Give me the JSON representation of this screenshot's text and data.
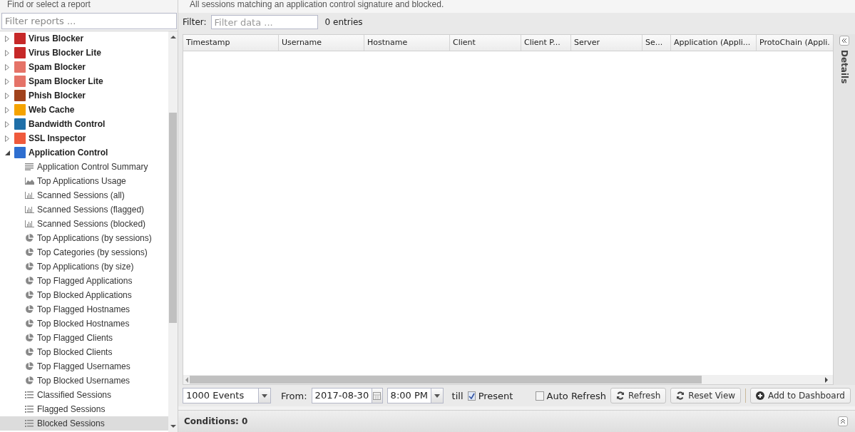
{
  "sidebar": {
    "title": "Find or select a report",
    "filter": {
      "placeholder": "Filter reports ..."
    },
    "tree": [
      {
        "label": "Virus Blocker",
        "expanded": false,
        "color": "#c62828"
      },
      {
        "label": "Virus Blocker Lite",
        "expanded": false,
        "color": "#c62828"
      },
      {
        "label": "Spam Blocker",
        "expanded": false,
        "color": "#e57368"
      },
      {
        "label": "Spam Blocker Lite",
        "expanded": false,
        "color": "#e57368"
      },
      {
        "label": "Phish Blocker",
        "expanded": false,
        "color": "#a0421c"
      },
      {
        "label": "Web Cache",
        "expanded": false,
        "color": "#f5a300"
      },
      {
        "label": "Bandwidth Control",
        "expanded": false,
        "color": "#1f6fa8"
      },
      {
        "label": "SSL Inspector",
        "expanded": false,
        "color": "#ef5a3c"
      },
      {
        "label": "Application Control",
        "expanded": true,
        "color": "#2f6fd0",
        "children": [
          {
            "label": "Application Control Summary",
            "kind": "text",
            "selected": false
          },
          {
            "label": "Top Applications Usage",
            "kind": "area",
            "selected": false
          },
          {
            "label": "Scanned Sessions (all)",
            "kind": "bar",
            "selected": false
          },
          {
            "label": "Scanned Sessions (flagged)",
            "kind": "bar",
            "selected": false
          },
          {
            "label": "Scanned Sessions (blocked)",
            "kind": "bar",
            "selected": false
          },
          {
            "label": "Top Applications (by sessions)",
            "kind": "pie",
            "selected": false
          },
          {
            "label": "Top Categories (by sessions)",
            "kind": "pie",
            "selected": false
          },
          {
            "label": "Top Applications (by size)",
            "kind": "pie",
            "selected": false
          },
          {
            "label": "Top Flagged Applications",
            "kind": "pie",
            "selected": false
          },
          {
            "label": "Top Blocked Applications",
            "kind": "pie",
            "selected": false
          },
          {
            "label": "Top Flagged Hostnames",
            "kind": "pie",
            "selected": false
          },
          {
            "label": "Top Blocked Hostnames",
            "kind": "pie",
            "selected": false
          },
          {
            "label": "Top Flagged Clients",
            "kind": "pie",
            "selected": false
          },
          {
            "label": "Top Blocked Clients",
            "kind": "pie",
            "selected": false
          },
          {
            "label": "Top Flagged Usernames",
            "kind": "pie",
            "selected": false
          },
          {
            "label": "Top Blocked Usernames",
            "kind": "pie",
            "selected": false
          },
          {
            "label": "Classified Sessions",
            "kind": "list",
            "selected": false
          },
          {
            "label": "Flagged Sessions",
            "kind": "list",
            "selected": false
          },
          {
            "label": "Blocked Sessions",
            "kind": "list",
            "selected": true
          }
        ]
      }
    ]
  },
  "report": {
    "description": "All sessions matching an application control signature and blocked.",
    "filter_label": "Filter:",
    "filter": {
      "placeholder": "Filter data ..."
    },
    "entries": "0 entries",
    "table": {
      "columns": [
        "Timestamp",
        "Username",
        "Hostname",
        "Client",
        "Client P...",
        "Server",
        "Se...",
        "Application (Appli...",
        "ProtoChain (Appli."
      ]
    },
    "details_label": "Details",
    "toolbar": {
      "events": "1000 Events",
      "from_label": "From:",
      "date": "2017-08-30",
      "time": "8:00 PM",
      "till_label": "till",
      "present": {
        "label": "Present",
        "checked": true
      },
      "auto_refresh": {
        "label": "Auto Refresh",
        "checked": false
      },
      "buttons": [
        {
          "label": "Refresh",
          "kind": "refresh"
        },
        {
          "label": "Reset View",
          "kind": "refresh"
        },
        {
          "label": "Add to Dashboard",
          "kind": "add"
        }
      ]
    },
    "conditions": "Conditions: 0"
  }
}
